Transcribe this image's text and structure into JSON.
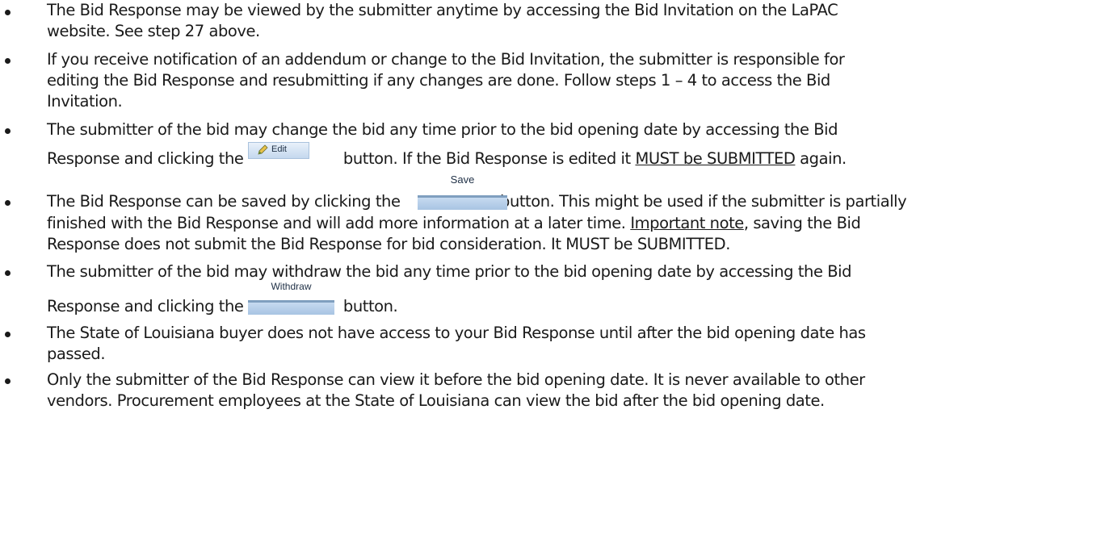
{
  "bullets": {
    "b1": {
      "line1": "The Bid Response may be viewed by the submitter anytime by accessing the Bid Invitation on the LaPAC",
      "line2": "website.  See step 27 above."
    },
    "b2": {
      "line1": "If you receive notification of an addendum or change to the Bid Invitation, the submitter is responsible for",
      "line2": "editing the Bid Response and resubmitting if any changes are done.  Follow steps 1 – 4 to access the Bid",
      "line3": "Invitation."
    },
    "b3": {
      "line1": "The submitter of the bid may change the bid any time prior to the bid opening date by accessing the Bid",
      "line2_a": "Response and clicking the",
      "line2_b": "button.  If the Bid Response is edited it",
      "line2_u": "MUST be SUBMITTED",
      "line2_c": "again."
    },
    "b4": {
      "line1_a": "The Bid Response can be saved by clicking the",
      "line1_b": "button.  This might be used if the submitter is partially",
      "line2": "finished with the Bid Response and will add more information at a later time.",
      "line2_u": "Important note",
      "line2_c": ", saving the Bid",
      "line3": "Response does not submit the Bid Response for bid consideration.  It MUST be SUBMITTED."
    },
    "b5": {
      "line1": "The submitter of the bid may withdraw the bid any time prior to the bid opening date by accessing the Bid",
      "line2_a": "Response and clicking the",
      "line2_b": "button."
    },
    "b6": {
      "line1": "The State of Louisiana buyer does not have access to your Bid Response until after the bid opening date has",
      "line2": "passed."
    },
    "b7": {
      "line1": "Only the submitter of the Bid Response can view it before the bid opening date.  It is never available to other",
      "line2": "vendors.  Procurement employees at the State of Louisiana can view the bid after the bid opening date."
    }
  },
  "buttons": {
    "edit_label": "Edit",
    "save_label": "Save",
    "withdraw_label": "Withdraw"
  },
  "icons": {
    "edit": "pencil-icon"
  }
}
